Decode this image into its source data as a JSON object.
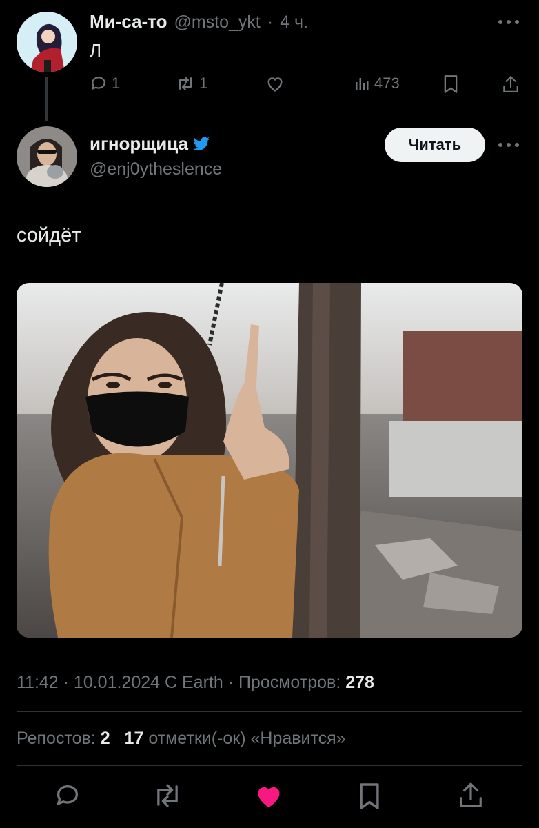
{
  "prev_tweet": {
    "name": "Ми-са-то",
    "handle": "@msto_ykt",
    "time": "4 ч.",
    "text": "Л",
    "replies": "1",
    "reposts": "1",
    "views": "473"
  },
  "main_tweet": {
    "name": "игнорщица",
    "handle": "@enj0ytheslence",
    "follow_label": "Читать",
    "text": "сойдёт",
    "meta_time": "11:42 · 10.01.2024 C Earth · Просмотров:",
    "meta_views": "278",
    "reposts_label": "Репостов:",
    "reposts_count": "2",
    "likes_count": "17",
    "likes_label": "отметки(-ок) «Нравится»"
  },
  "colors": {
    "background": "#000000",
    "text": "#e7e9ea",
    "muted": "#71767b",
    "like_active": "#f91880",
    "verified": "#1d9bf0"
  }
}
